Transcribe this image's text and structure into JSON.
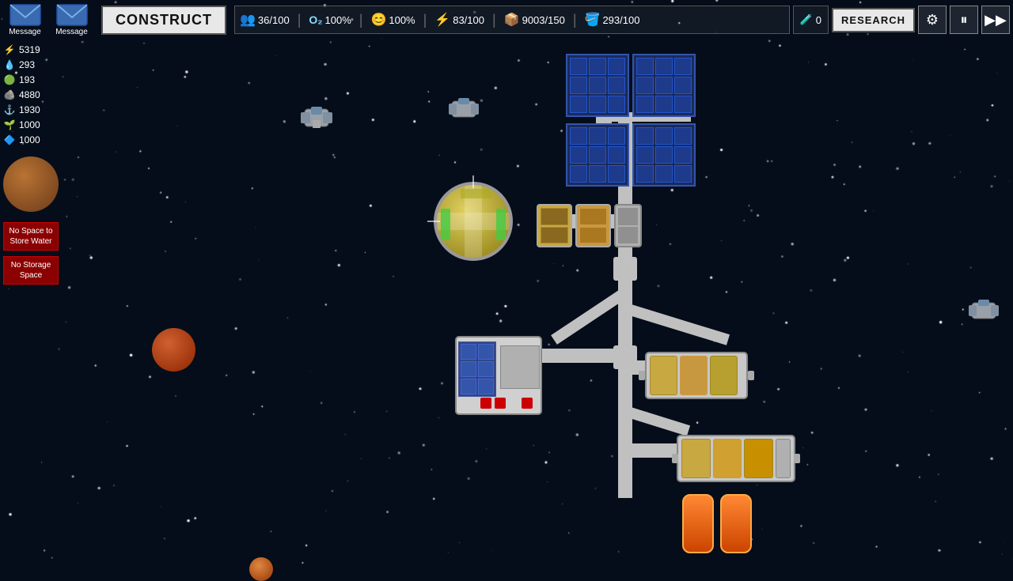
{
  "topbar": {
    "message1_label": "Message",
    "message2_label": "Message",
    "construct_label": "CONSTRUCT",
    "research_label": "RESEARCH",
    "stats": {
      "crew": "36/100",
      "oxygen": "100%",
      "health": "100%",
      "power": "83/100",
      "storage": "9003/150",
      "water": "293/100",
      "flask": "0"
    }
  },
  "resources": [
    {
      "icon": "⚡",
      "value": "5319",
      "color": "#ffdd44"
    },
    {
      "icon": "💧",
      "value": "293",
      "color": "#44aaff"
    },
    {
      "icon": "🌿",
      "value": "193",
      "color": "#44cc44"
    },
    {
      "icon": "🪨",
      "value": "4880",
      "color": "#aaaaaa"
    },
    {
      "icon": "⚓",
      "value": "1930",
      "color": "#88aacc"
    },
    {
      "icon": "🌱",
      "value": "1000",
      "color": "#55cc55"
    },
    {
      "icon": "🔷",
      "value": "1000",
      "color": "#6688cc"
    }
  ],
  "alerts": [
    {
      "label": "No Space to\nStore Water"
    },
    {
      "label": "No Storage\nSpace"
    }
  ],
  "colors": {
    "space_bg": "#050d1a",
    "accent": "#4488ff",
    "module_bg": "#c8c8c8",
    "connector": "#b0b0b0"
  }
}
